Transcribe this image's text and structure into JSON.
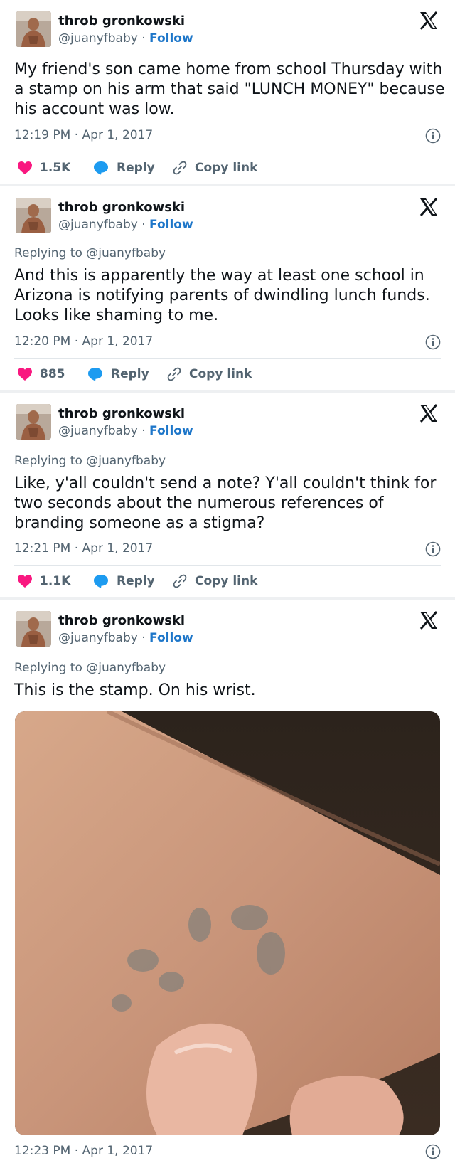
{
  "colors": {
    "accent": "#1d76c9",
    "like": "#f91880",
    "reply": "#1d9bf0",
    "muted": "#536471"
  },
  "icons": {
    "brand": "x-logo-icon",
    "info": "info-icon",
    "like": "heart-icon",
    "reply": "reply-bubble-icon",
    "copy": "link-icon"
  },
  "tweets": [
    {
      "name": "throb gronkowski",
      "handle": "@juanyfbaby",
      "separator": "·",
      "follow": "Follow",
      "replying": "",
      "text": "My friend's son came home from school Thursday with a stamp on his arm that said \"LUNCH MONEY\" because his account was low.",
      "time": "12:19 PM · Apr 1, 2017",
      "likes": "1.5K",
      "reply": "Reply",
      "copy": "Copy link"
    },
    {
      "name": "throb gronkowski",
      "handle": "@juanyfbaby",
      "separator": "·",
      "follow": "Follow",
      "replying": "Replying to @juanyfbaby",
      "text": "And this is apparently the way at least one school in Arizona is notifying parents of dwindling lunch funds. Looks like shaming to me.",
      "time": "12:20 PM · Apr 1, 2017",
      "likes": "885",
      "reply": "Reply",
      "copy": "Copy link"
    },
    {
      "name": "throb gronkowski",
      "handle": "@juanyfbaby",
      "separator": "·",
      "follow": "Follow",
      "replying": "Replying to @juanyfbaby",
      "text": "Like, y'all couldn't send a note? Y'all couldn't think for two seconds about the numerous references of branding someone as a stigma?",
      "time": "12:21 PM · Apr 1, 2017",
      "likes": "1.1K",
      "reply": "Reply",
      "copy": "Copy link"
    },
    {
      "name": "throb gronkowski",
      "handle": "@juanyfbaby",
      "separator": "·",
      "follow": "Follow",
      "replying": "Replying to @juanyfbaby",
      "text": "This is the stamp. On his wrist.",
      "time": "12:23 PM · Apr 1, 2017"
    }
  ]
}
